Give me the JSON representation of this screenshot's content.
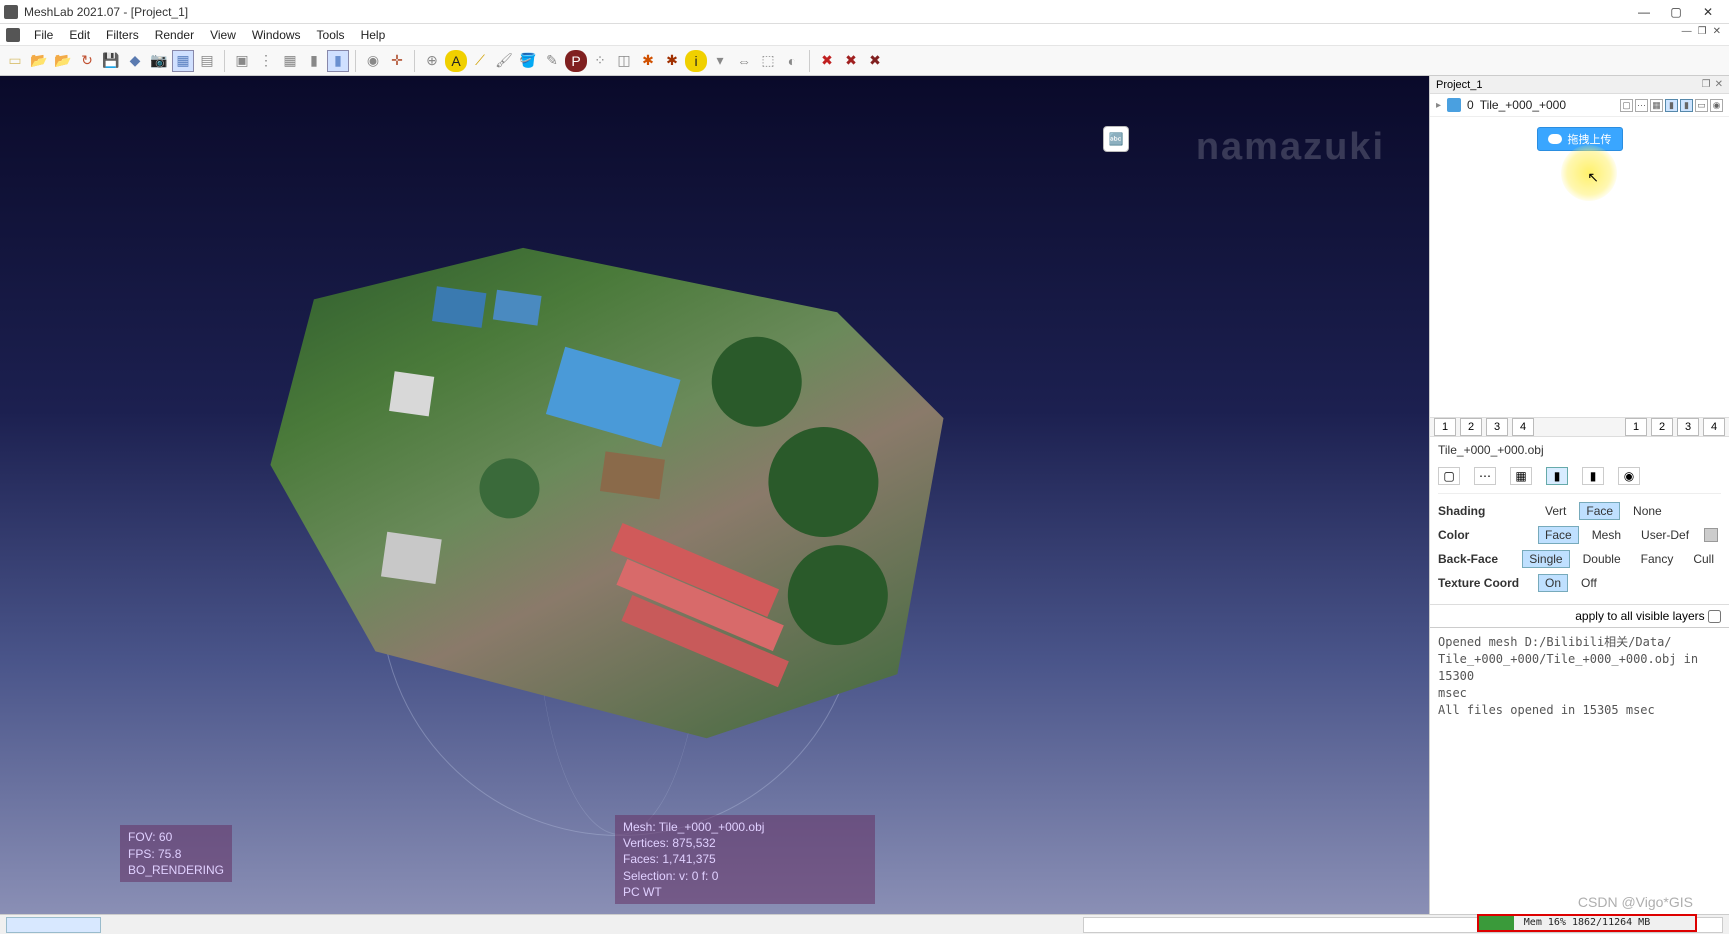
{
  "window": {
    "title": "MeshLab 2021.07 - [Project_1]"
  },
  "menu": [
    "File",
    "Edit",
    "Filters",
    "Render",
    "View",
    "Windows",
    "Tools",
    "Help"
  ],
  "toolbar_icons": [
    {
      "name": "new-project-icon",
      "glyph": "▭",
      "color": "#d8c070"
    },
    {
      "name": "open-project-icon",
      "glyph": "📂",
      "color": "#d8a030"
    },
    {
      "name": "import-mesh-icon",
      "glyph": "📂",
      "color": "#d8a030"
    },
    {
      "name": "reload-icon",
      "glyph": "↻",
      "color": "#c05030"
    },
    {
      "name": "export-mesh-icon",
      "glyph": "💾",
      "color": "#5a7ab0"
    },
    {
      "name": "save-project-icon",
      "glyph": "◆",
      "color": "#5a7ab0"
    },
    {
      "name": "snapshot-icon",
      "glyph": "📷",
      "color": "#555"
    },
    {
      "name": "layer-dialog-icon",
      "glyph": "▦",
      "color": "#5a80c0",
      "active": true
    },
    {
      "name": "raster-icon",
      "glyph": "▤",
      "color": "#888"
    },
    {
      "sep": true
    },
    {
      "name": "bbox-icon",
      "glyph": "▣",
      "color": "#888"
    },
    {
      "name": "points-icon",
      "glyph": "⋮",
      "color": "#888"
    },
    {
      "name": "wireframe-icon",
      "glyph": "▦",
      "color": "#888"
    },
    {
      "name": "flat-icon",
      "glyph": "▮",
      "color": "#888"
    },
    {
      "name": "smooth-icon",
      "glyph": "▮",
      "color": "#6a90d0",
      "active": true
    },
    {
      "sep": true
    },
    {
      "name": "light-icon",
      "glyph": "◉",
      "color": "#888"
    },
    {
      "name": "axis-icon",
      "glyph": "✛",
      "color": "#b05030"
    },
    {
      "sep": true
    },
    {
      "name": "globe-icon",
      "glyph": "⊕",
      "color": "#888"
    },
    {
      "name": "label-icon",
      "glyph": "A",
      "color": "#222",
      "bg": "#f0d000"
    },
    {
      "name": "measure-icon",
      "glyph": "⟋",
      "color": "#d0a000"
    },
    {
      "name": "paint-icon",
      "glyph": "🖌",
      "color": "#888"
    },
    {
      "name": "fill-icon",
      "glyph": "🪣",
      "color": "#888"
    },
    {
      "name": "pencil-icon",
      "glyph": "✎",
      "color": "#888"
    },
    {
      "name": "p-icon",
      "glyph": "P",
      "color": "#fff",
      "bg": "#802020"
    },
    {
      "name": "select-vert-icon",
      "glyph": "⁘",
      "color": "#888"
    },
    {
      "name": "select-face-icon",
      "glyph": "◫",
      "color": "#888"
    },
    {
      "name": "star-icon",
      "glyph": "✱",
      "color": "#d05000"
    },
    {
      "name": "star2-icon",
      "glyph": "✱",
      "color": "#a03000"
    },
    {
      "name": "info-icon",
      "glyph": "i",
      "color": "#222",
      "bg": "#f0d000"
    },
    {
      "name": "align-icon",
      "glyph": "▾",
      "color": "#888"
    },
    {
      "name": "manip-icon",
      "glyph": "⇔",
      "color": "#888"
    },
    {
      "name": "ref-icon",
      "glyph": "⬚",
      "color": "#888"
    },
    {
      "name": "zbrush-icon",
      "glyph": "◐",
      "color": "#888"
    },
    {
      "sep": true
    },
    {
      "name": "delete-sel-vert-icon",
      "glyph": "✖",
      "color": "#c02020"
    },
    {
      "name": "delete-sel-face-icon",
      "glyph": "✖",
      "color": "#a02020"
    },
    {
      "name": "delete-sel-both-icon",
      "glyph": "✖",
      "color": "#802020"
    }
  ],
  "project_panel": {
    "title": "Project_1",
    "layer": {
      "index": "0",
      "name": "Tile_+000_+000"
    },
    "upload_label": "拖拽上传"
  },
  "view_tabs_left": [
    "1",
    "2",
    "3",
    "4"
  ],
  "view_tabs_right": [
    "1",
    "2",
    "3",
    "4"
  ],
  "render": {
    "filename": "Tile_+000_+000.obj",
    "shading": {
      "label": "Shading",
      "options": [
        "Vert",
        "Face",
        "None"
      ],
      "active": "Face"
    },
    "color": {
      "label": "Color",
      "options": [
        "Face",
        "Mesh",
        "User-Def"
      ],
      "active": "Face"
    },
    "backface": {
      "label": "Back-Face",
      "options": [
        "Single",
        "Double",
        "Fancy",
        "Cull"
      ],
      "active": "Single"
    },
    "texcoord": {
      "label": "Texture Coord",
      "options": [
        "On",
        "Off"
      ],
      "active": "On"
    },
    "apply_label": "apply to all visible layers"
  },
  "log": "Opened mesh D:/Bilibili相关/Data/\nTile_+000_+000/Tile_+000_+000.obj in 15300\nmsec\nAll files opened in 15305 msec",
  "memory": {
    "text": "Mem 16% 1862/11264 MB"
  },
  "overlay_left": {
    "fov": "FOV: 60",
    "fps": "FPS: 75.8",
    "mode": "BO_RENDERING"
  },
  "overlay_mid": {
    "mesh": "Mesh: Tile_+000_+000.obj",
    "verts": "Vertices: 875,532",
    "faces": "Faces: 1,741,375",
    "sel": "Selection: v: 0 f: 0",
    "pc": "PC WT"
  },
  "watermark_tr": "namazuki",
  "watermark_br": "CSDN @Vigo*GIS"
}
